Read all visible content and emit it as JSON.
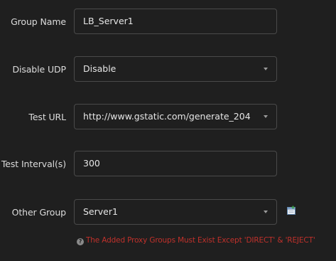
{
  "form": {
    "group_name": {
      "label": "Group Name",
      "value": "LB_Server1"
    },
    "disable_udp": {
      "label": "Disable UDP",
      "value": "Disable"
    },
    "test_url": {
      "label": "Test URL",
      "value": "http://www.gstatic.com/generate_204"
    },
    "test_interval": {
      "label": "Test Interval(s)",
      "value": "300"
    },
    "other_group": {
      "label": "Other Group",
      "value": "Server1"
    }
  },
  "hint": {
    "icon": "question-circle-icon",
    "text": "The Added Proxy Groups Must Exist Except 'DIRECT' & 'REJECT'"
  },
  "colors": {
    "background": "#1f1f1f",
    "border": "#4a4a4a",
    "hint": "#c0312b"
  }
}
